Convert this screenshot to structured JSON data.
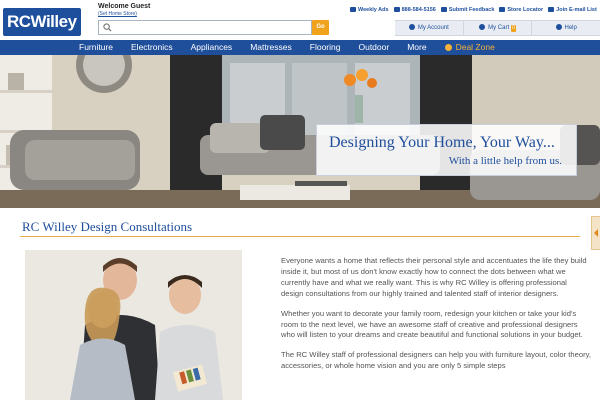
{
  "header": {
    "logo_text": "RCWilley",
    "welcome": "Welcome Guest",
    "set_store": "(Set Home Store)",
    "search": {
      "placeholder": "",
      "go_label": "Go"
    },
    "utility_links": [
      {
        "label": "Weekly Ads",
        "icon": "megaphone-icon"
      },
      {
        "label": "888-584-5156",
        "icon": "phone-icon"
      },
      {
        "label": "Submit Feedback",
        "icon": "speech-bubble-icon"
      },
      {
        "label": "Store Locator",
        "icon": "map-pin-icon"
      },
      {
        "label": "Join E-mail List",
        "icon": "envelope-icon"
      }
    ],
    "account_bar": {
      "my_account": "My Account",
      "my_cart": "My Cart",
      "cart_count": "0",
      "help": "Help"
    }
  },
  "nav": {
    "items": [
      "Furniture",
      "Electronics",
      "Appliances",
      "Mattresses",
      "Flooring",
      "Outdoor",
      "More"
    ],
    "deal_zone": "Deal Zone"
  },
  "hero": {
    "headline": "Designing Your Home, Your Way...",
    "subline": "With a little help from us."
  },
  "content": {
    "title": "RC Willey Design Consultations",
    "paragraphs": [
      "Everyone wants a home that reflects their personal style and accentuates the life they build inside it, but most of us don't know exactly how to connect the dots between what we currently have and what we really want. This is why RC Willey is offering professional design consultations from our highly trained and talented staff of interior designers.",
      "Whether you want to decorate your family room, redesign your kitchen or take your kid's room to the next level, we have an awesome staff of creative and professional designers who will listen to your dreams and create beautiful and functional solutions in your budget.",
      "The RC Willey staff of professional designers can help you with furniture layout, color theory, accessories, or whole home vision and you are only 5 simple steps"
    ]
  },
  "colors": {
    "brand_blue": "#1f4e9b",
    "accent_orange": "#f0a21c",
    "rule_orange": "#e8a94a"
  }
}
